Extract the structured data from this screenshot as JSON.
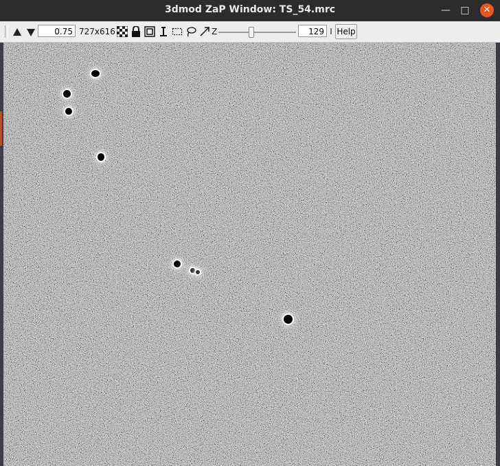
{
  "window": {
    "title": "3dmod ZaP Window: TS_54.mrc",
    "minimize_icon": "minimize-icon",
    "maximize_icon": "maximize-icon",
    "close_icon": "close-icon"
  },
  "toolbar": {
    "up_arrow_icon": "up-arrow-icon",
    "down_arrow_icon": "down-arrow-icon",
    "zoom_value": "0.75",
    "image_size": "727x616",
    "z_label": "Z",
    "z_value": "129",
    "help_label": "Help",
    "icons": [
      "checker-icon",
      "lock-icon",
      "center-icon",
      "insert-icon",
      "rubberband-icon",
      "lasso-icon",
      "arrow-icon"
    ]
  },
  "view": {
    "image_bg": "#8e8e8e",
    "beads_count_visible": 8
  }
}
